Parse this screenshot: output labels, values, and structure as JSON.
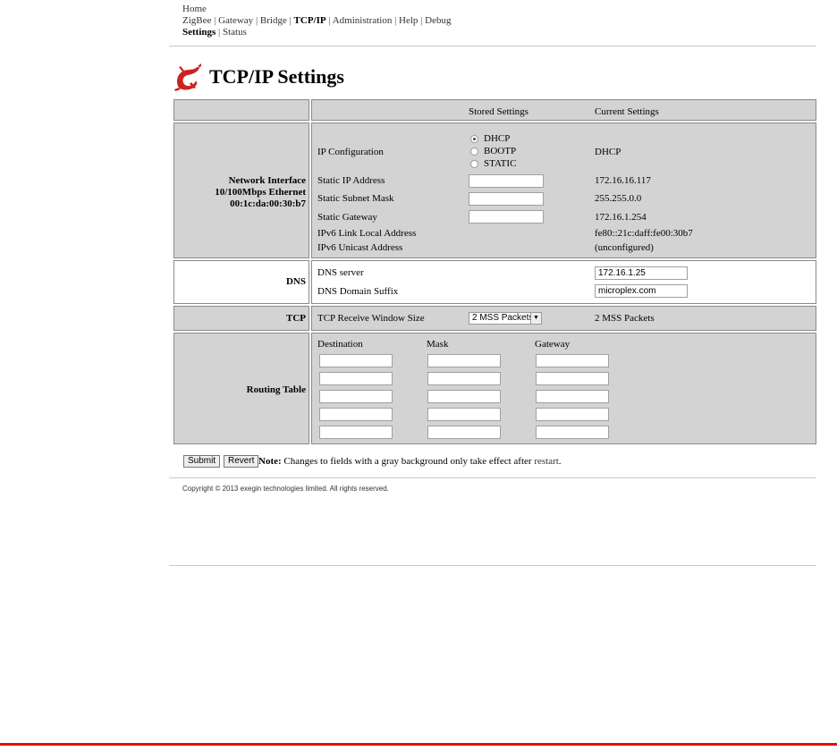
{
  "nav": {
    "home": "Home",
    "row2": [
      "ZigBee",
      "Gateway",
      "Bridge",
      "TCP/IP",
      "Administration",
      "Help",
      "Debug"
    ],
    "row2_active": "TCP/IP",
    "row3": [
      "Settings",
      "Status"
    ],
    "row3_active": "Settings"
  },
  "page_title": "TCP/IP Settings",
  "headers": {
    "stored": "Stored Settings",
    "current": "Current Settings"
  },
  "network": {
    "label_lines": [
      "Network Interface",
      "10/100Mbps Ethernet",
      "00:1c:da:00:30:b7"
    ],
    "ip_config_label": "IP Configuration",
    "ip_options": [
      "DHCP",
      "BOOTP",
      "STATIC"
    ],
    "ip_selected": "DHCP",
    "ip_current": "DHCP",
    "static_ip_label": "Static IP Address",
    "static_ip_current": "172.16.16.117",
    "subnet_label": "Static Subnet Mask",
    "subnet_current": "255.255.0.0",
    "gateway_label": "Static Gateway",
    "gateway_current": "172.16.1.254",
    "ipv6_ll_label": "IPv6 Link Local Address",
    "ipv6_ll_current": "fe80::21c:daff:fe00:30b7",
    "ipv6_uc_label": "IPv6 Unicast Address",
    "ipv6_uc_current": "(unconfigured)"
  },
  "dns": {
    "label": "DNS",
    "server_label": "DNS server",
    "server_value": "172.16.1.25",
    "suffix_label": "DNS Domain Suffix",
    "suffix_value": "microplex.com"
  },
  "tcp": {
    "label": "TCP",
    "window_label": "TCP Receive Window Size",
    "window_selected": "2 MSS Packets",
    "window_current": "2 MSS Packets"
  },
  "routing": {
    "label": "Routing Table",
    "columns": [
      "Destination",
      "Mask",
      "Gateway"
    ],
    "rows": 5
  },
  "footer": {
    "submit": "Submit",
    "revert": "Revert",
    "note_bold": "Note:",
    "note_text": "Changes to fields with a gray background only take effect after",
    "note_link": "restart",
    "copyright": "Copyright © 2013 exegin technologies limited. All rights reserved."
  },
  "colors": {
    "accent_red": "#cc2222",
    "panel_gray": "#d3d3d3"
  }
}
